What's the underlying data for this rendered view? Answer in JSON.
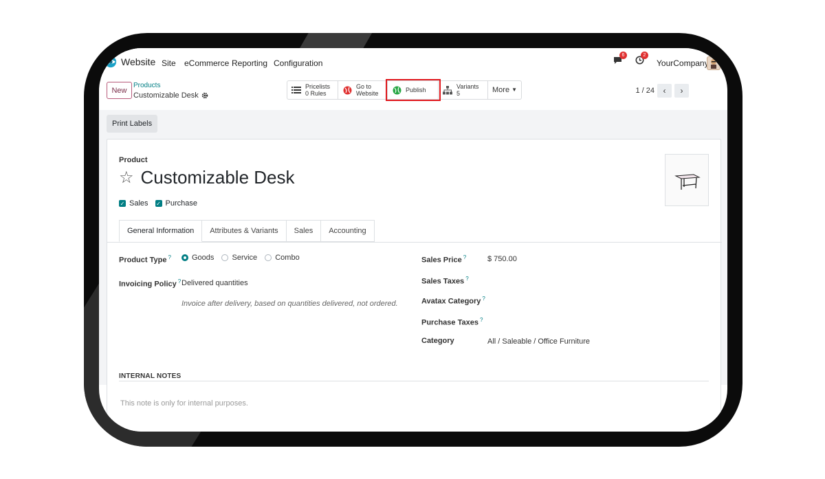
{
  "navbar": {
    "brand": "Website",
    "menus": [
      "Site",
      "eCommerce",
      "Reporting",
      "Configuration"
    ],
    "messages_count": "6",
    "activity_count": "2",
    "company": "YourCompany"
  },
  "control": {
    "new_label": "New",
    "breadcrumb_parent": "Products",
    "breadcrumb_current": "Customizable Desk",
    "smart_buttons": {
      "pricelists_title": "Pricelists",
      "pricelists_value": "0 Rules",
      "goto_line1": "Go to",
      "goto_line2": "Website",
      "publish": "Publish",
      "variants_title": "Variants",
      "variants_value": "5",
      "more": "More"
    },
    "pager": "1 / 24"
  },
  "actions": {
    "print_labels": "Print Labels"
  },
  "form": {
    "product_label": "Product",
    "name": "Customizable Desk",
    "sales_label": "Sales",
    "purchase_label": "Purchase",
    "tabs": [
      "General Information",
      "Attributes & Variants",
      "Sales",
      "Accounting"
    ],
    "product_type_label": "Product Type",
    "product_type_options": [
      "Goods",
      "Service",
      "Combo"
    ],
    "product_type_selected": "Goods",
    "invoicing_policy_label": "Invoicing Policy",
    "invoicing_policy_value": "Delivered quantities",
    "invoicing_hint": "Invoice after delivery, based on quantities delivered, not ordered.",
    "sales_price_label": "Sales Price",
    "sales_price_value": "$ 750.00",
    "sales_taxes_label": "Sales Taxes",
    "avatax_label": "Avatax Category",
    "purchase_taxes_label": "Purchase Taxes",
    "category_label": "Category",
    "category_value": "All / Saleable / Office Furniture",
    "internal_notes_label": "INTERNAL NOTES",
    "internal_notes_placeholder": "This note is only for internal purposes."
  },
  "colors": {
    "accent": "#017e84",
    "highlight": "#e0161b",
    "brand_primary": "#714b67"
  },
  "icons": [
    "website-logo-icon",
    "chat-icon",
    "activity-clock-icon",
    "gear-icon",
    "list-icon",
    "globe-icon",
    "sitemap-icon",
    "star-icon",
    "chevron-left-icon",
    "chevron-right-icon",
    "caret-down-icon"
  ]
}
